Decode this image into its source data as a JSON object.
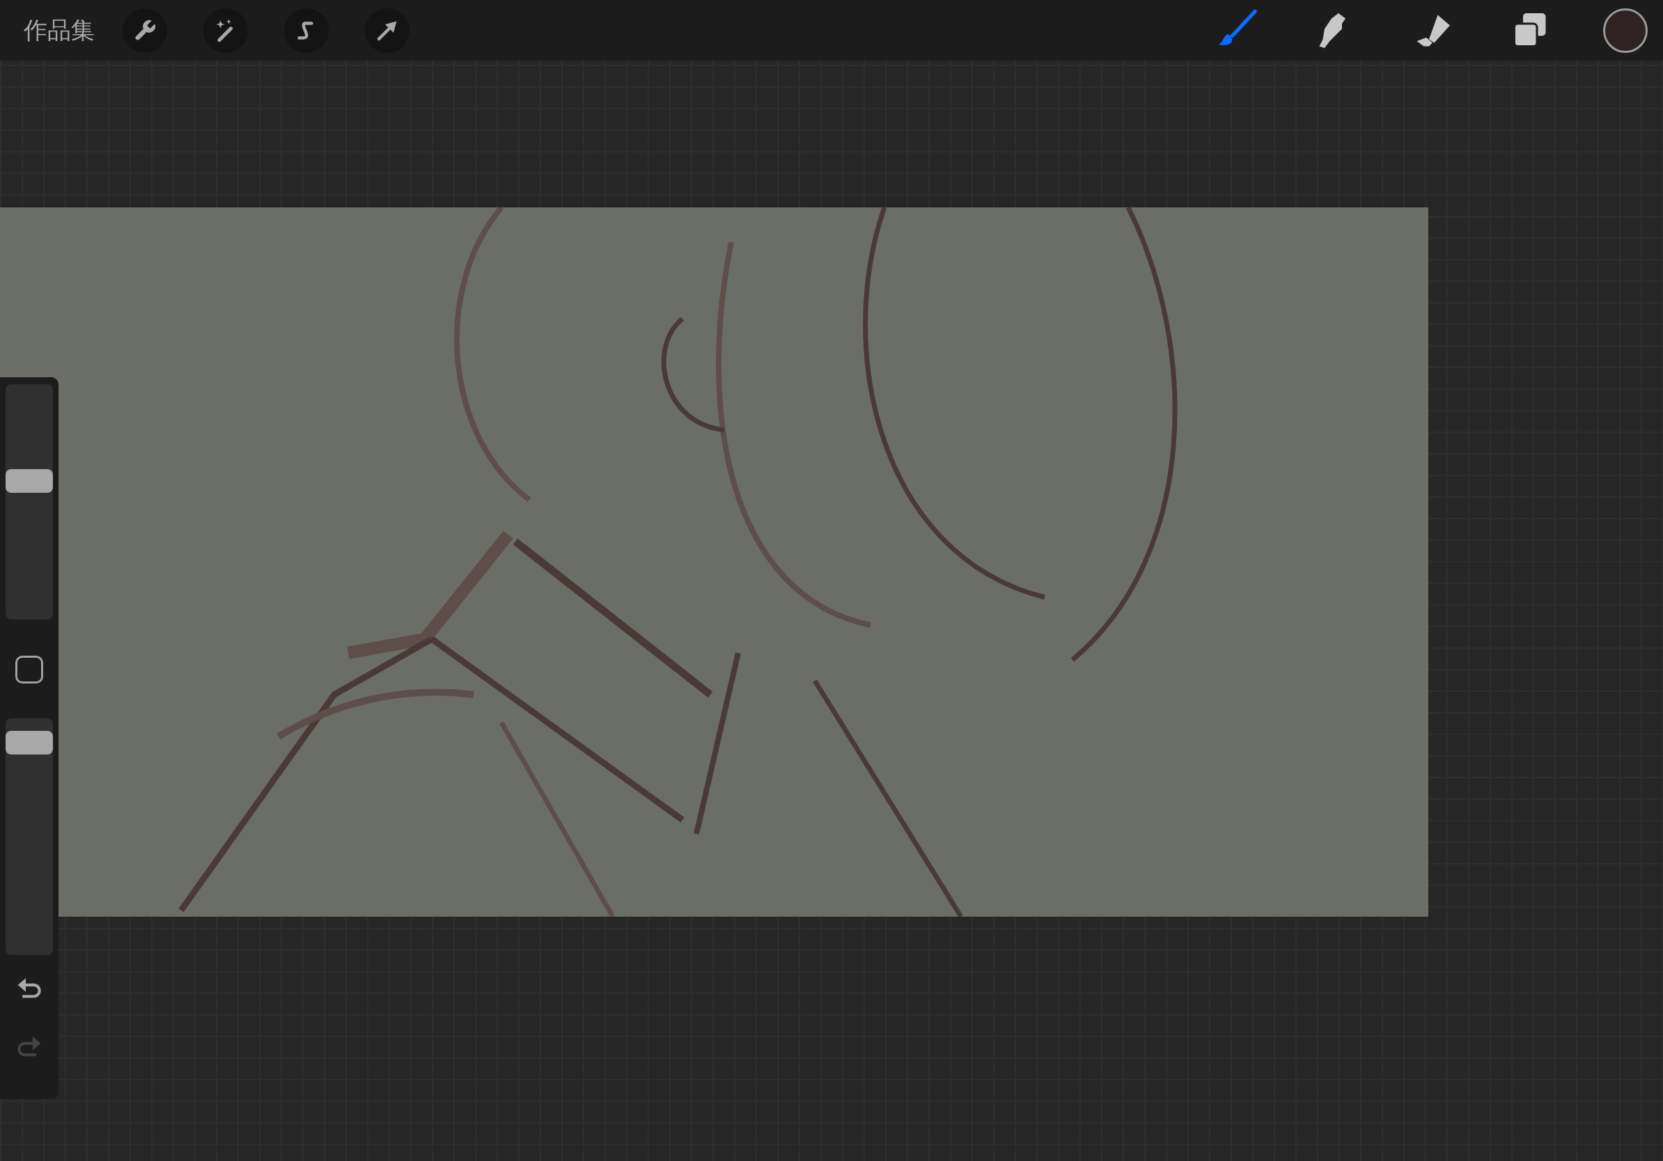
{
  "top_bar": {
    "gallery_label": "作品集",
    "left_tools": [
      {
        "kind": "wrench"
      },
      {
        "kind": "wand"
      },
      {
        "kind": "select"
      },
      {
        "kind": "move"
      }
    ],
    "right_tools": [
      {
        "kind": "brush",
        "selected": true
      },
      {
        "kind": "smudge",
        "selected": false
      },
      {
        "kind": "eraser",
        "selected": false
      },
      {
        "kind": "layers",
        "selected": false
      }
    ],
    "color_swatch": {
      "color": "#2e2222"
    }
  },
  "sidebar": {
    "size_slider": {
      "level": 0.6
    },
    "opacity_slider": {
      "level": 0.94
    },
    "undo": {
      "disabled": false
    },
    "redo": {
      "disabled": true
    }
  }
}
